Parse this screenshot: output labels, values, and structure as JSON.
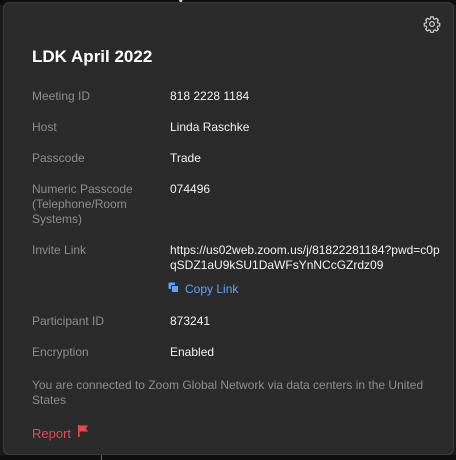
{
  "meeting": {
    "title": "LDK April 2022"
  },
  "fields": {
    "meeting_id_label": "Meeting ID",
    "meeting_id_value": "818 2228 1184",
    "host_label": "Host",
    "host_value": "Linda Raschke",
    "passcode_label": "Passcode",
    "passcode_value": "Trade",
    "numeric_passcode_label": "Numeric Passcode (Telephone/Room Systems)",
    "numeric_passcode_value": "074496",
    "invite_link_label": "Invite Link",
    "invite_link_value": "https://us02web.zoom.us/j/81822281184?pwd=c0pqSDZ1aU9kSU1DaWFsYnNCcGZrdz09",
    "copy_link_label": "Copy Link",
    "participant_id_label": "Participant ID",
    "participant_id_value": "873241",
    "encryption_label": "Encryption",
    "encryption_value": "Enabled"
  },
  "notice": "You are connected to Zoom Global Network via data centers in the United States",
  "report": {
    "label": "Report"
  },
  "icons": {
    "settings": "gear-icon",
    "copy": "copy-icon",
    "report": "flag-icon"
  },
  "colors": {
    "panel_background": "#2a2a2b",
    "link_blue": "#5ea3ff",
    "report_red": "#e8474d",
    "label_gray": "#8d8d8d",
    "value_white": "#f2f2f2"
  }
}
